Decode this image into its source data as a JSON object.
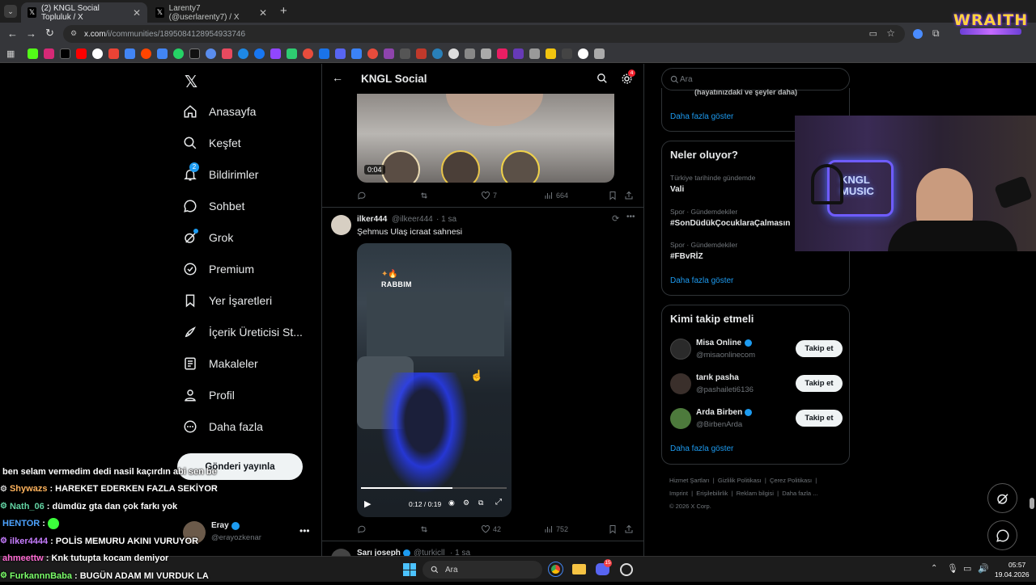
{
  "browser": {
    "tabs": [
      {
        "title": "(2) KNGL Social Topluluk / X"
      },
      {
        "title": "Larenty7 (@userlarenty7) / X"
      }
    ],
    "url_host": "x.com",
    "url_path": "/i/communities/1895084128954933746",
    "overlay_logo": "WRAITH"
  },
  "nav": {
    "items": [
      {
        "label": "Anasayfa",
        "icon": "home-icon"
      },
      {
        "label": "Keşfet",
        "icon": "search-icon"
      },
      {
        "label": "Bildirimler",
        "icon": "bell-icon",
        "badge": "2"
      },
      {
        "label": "Sohbet",
        "icon": "chat-icon"
      },
      {
        "label": "Grok",
        "icon": "grok-icon"
      },
      {
        "label": "Premium",
        "icon": "premium-icon"
      },
      {
        "label": "Yer İşaretleri",
        "icon": "bookmark-icon"
      },
      {
        "label": "İçerik Üreticisi St...",
        "icon": "rocket-icon"
      },
      {
        "label": "Makaleler",
        "icon": "article-icon"
      },
      {
        "label": "Profil",
        "icon": "person-icon"
      },
      {
        "label": "Daha fazla",
        "icon": "more-circle-icon"
      }
    ],
    "post_button": "Gönderi yayınla",
    "user": {
      "name": "Eray",
      "handle": "@erayozkenar"
    }
  },
  "feed": {
    "title": "KNGL Social",
    "settings_badge": "4",
    "top_video_time": "0:04",
    "top_post_stats": {
      "likes": "7",
      "views": "664"
    },
    "post": {
      "name": "ilker444",
      "handle": "@ilkeer444",
      "time": "· 1 sa",
      "text": "Şehmus Ulaş icraat sahnesi",
      "video_caption": "RABBIM",
      "video_time": "0:12 / 0:19",
      "likes": "42",
      "views": "752"
    },
    "next_post": {
      "name": "Sarı joseph",
      "handle": "@turkicll",
      "time": "· 1 sa"
    }
  },
  "right": {
    "search_placeholder": "Ara",
    "top_text": "(hayatınızdaki ve şeyler daha)",
    "show_more": "Daha fazla göster",
    "trends_title": "Neler oluyor?",
    "trends": [
      {
        "context": "Türkiye tarihinde gündemde",
        "name": "Vali"
      },
      {
        "context": "Spor · Gündemdekiler",
        "name": "#SonDüdükÇocuklaraÇalmasın"
      },
      {
        "context": "Spor · Gündemdekiler",
        "name": "#FBvRİZ"
      }
    ],
    "follow_title": "Kimi takip etmeli",
    "follow_label": "Takip et",
    "suggestions": [
      {
        "name": "Misa Online",
        "handle": "@misaonlinecom",
        "verified": true
      },
      {
        "name": "tarık pasha",
        "handle": "@pashaileti6136",
        "verified": false
      },
      {
        "name": "Arda Birben",
        "handle": "@BirbenArda",
        "verified": true
      }
    ],
    "footer_line1": [
      "Hizmet Şartları",
      "Gizlilik Politikası",
      "Çerez Politikası"
    ],
    "footer_line2": [
      "Imprint",
      "Erişilebilirlik",
      "Reklam bilgisi",
      "Daha fazla ..."
    ],
    "copyright": "© 2026 X Corp."
  },
  "webcam": {
    "neon_line1": "KNGL",
    "neon_line2": "MUSIC"
  },
  "chat": [
    {
      "user": "",
      "msg": "ben selam vermedim dedi nasil kaçırdın abi sen be",
      "color": "#ffffff"
    },
    {
      "user": "Shywazs",
      "msg": ": HAREKET EDERKEN FAZLA SEKİYOR",
      "color": "#ffb35c"
    },
    {
      "user": "Nath_06",
      "msg": ": dümdüz gta dan çok farkı yok",
      "color": "#62d2a2"
    },
    {
      "user": "HENTOR",
      "msg": ":",
      "color": "#4da3ff"
    },
    {
      "user": "ilker4444",
      "msg": ": POLİS MEMURU AKINI VURUYOR",
      "color": "#c77dff"
    },
    {
      "user": "ahmeettw",
      "msg": ": Knk tutupta kocam demiyor",
      "color": "#ff6bd3"
    },
    {
      "user": "FurkannnBaba",
      "msg": ": BUGÜN ADAM MI VURDUK LA",
      "color": "#7cff6b"
    }
  ],
  "taskbar": {
    "search_placeholder": "Ara",
    "time": "05:57",
    "date": "19.04.2026",
    "discord_badge": "15"
  }
}
